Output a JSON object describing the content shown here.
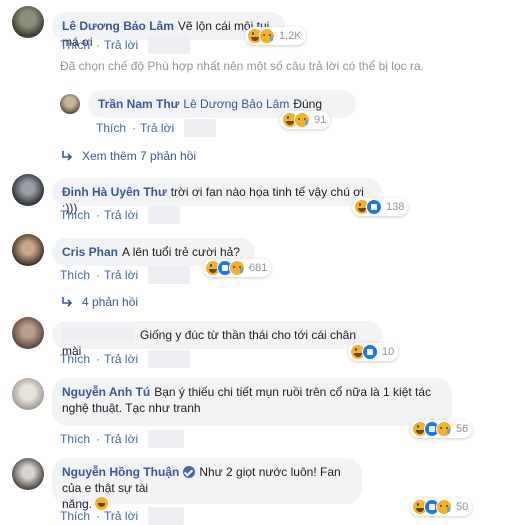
{
  "colors": {
    "link": "#385898",
    "bubble": "#f2f3f5",
    "muted": "#90949c"
  },
  "actions": {
    "like": "Thích",
    "reply": "Trả lời",
    "separator": "·"
  },
  "filter_notice": "Đã chọn chế độ Phù hợp nhất nên một số câu trả lời có thể bị lọc ra.",
  "comments": [
    {
      "author": "Lê Dương Bảo Lâm",
      "text": "Vẽ lộn cái môi tui má ơi",
      "reactions": [
        "haha",
        "sad"
      ],
      "count": "1,2K"
    },
    {
      "author": "Trần Nam Thư",
      "mention": "Lê Dương Bảo Lâm",
      "text": "Đúng",
      "reactions": [
        "haha",
        "sad"
      ],
      "count": "91"
    },
    {
      "author": "Đinh Hà Uyên Thư",
      "text": "trời ơi fan nào họa tinh tế vậy chú ơi :)))",
      "reactions": [
        "haha",
        "like"
      ],
      "count": "138"
    },
    {
      "author": "Cris Phan",
      "text": "A lên tuổi trẻ cười hả?",
      "reactions": [
        "haha",
        "like",
        "sad"
      ],
      "count": "681"
    },
    {
      "author": "",
      "text": "Giống y đúc từ thần thái cho tới cái chân mài",
      "reactions": [
        "haha",
        "like"
      ],
      "count": "10"
    },
    {
      "author": "Nguyễn Anh Tú",
      "text_line1": "Bạn ý thiếu chi tiết mụn ruồi trên cổ nữa là 1 kiệt tác",
      "text_line2": "nghệ thuật. Tạc như tranh",
      "reactions": [
        "haha",
        "like",
        "sad"
      ],
      "count": "56"
    },
    {
      "author": "Nguyễn Hồng Thuận",
      "text_line1": "Như 2 giọt nước luôn! Fan của e thật sự tài",
      "text_line2": "năng.",
      "reactions": [
        "haha",
        "like",
        "sad"
      ],
      "count": "50"
    }
  ],
  "view_more_replies": "Xem thêm 7 phản hồi",
  "replies_count": "4 phản hồi"
}
